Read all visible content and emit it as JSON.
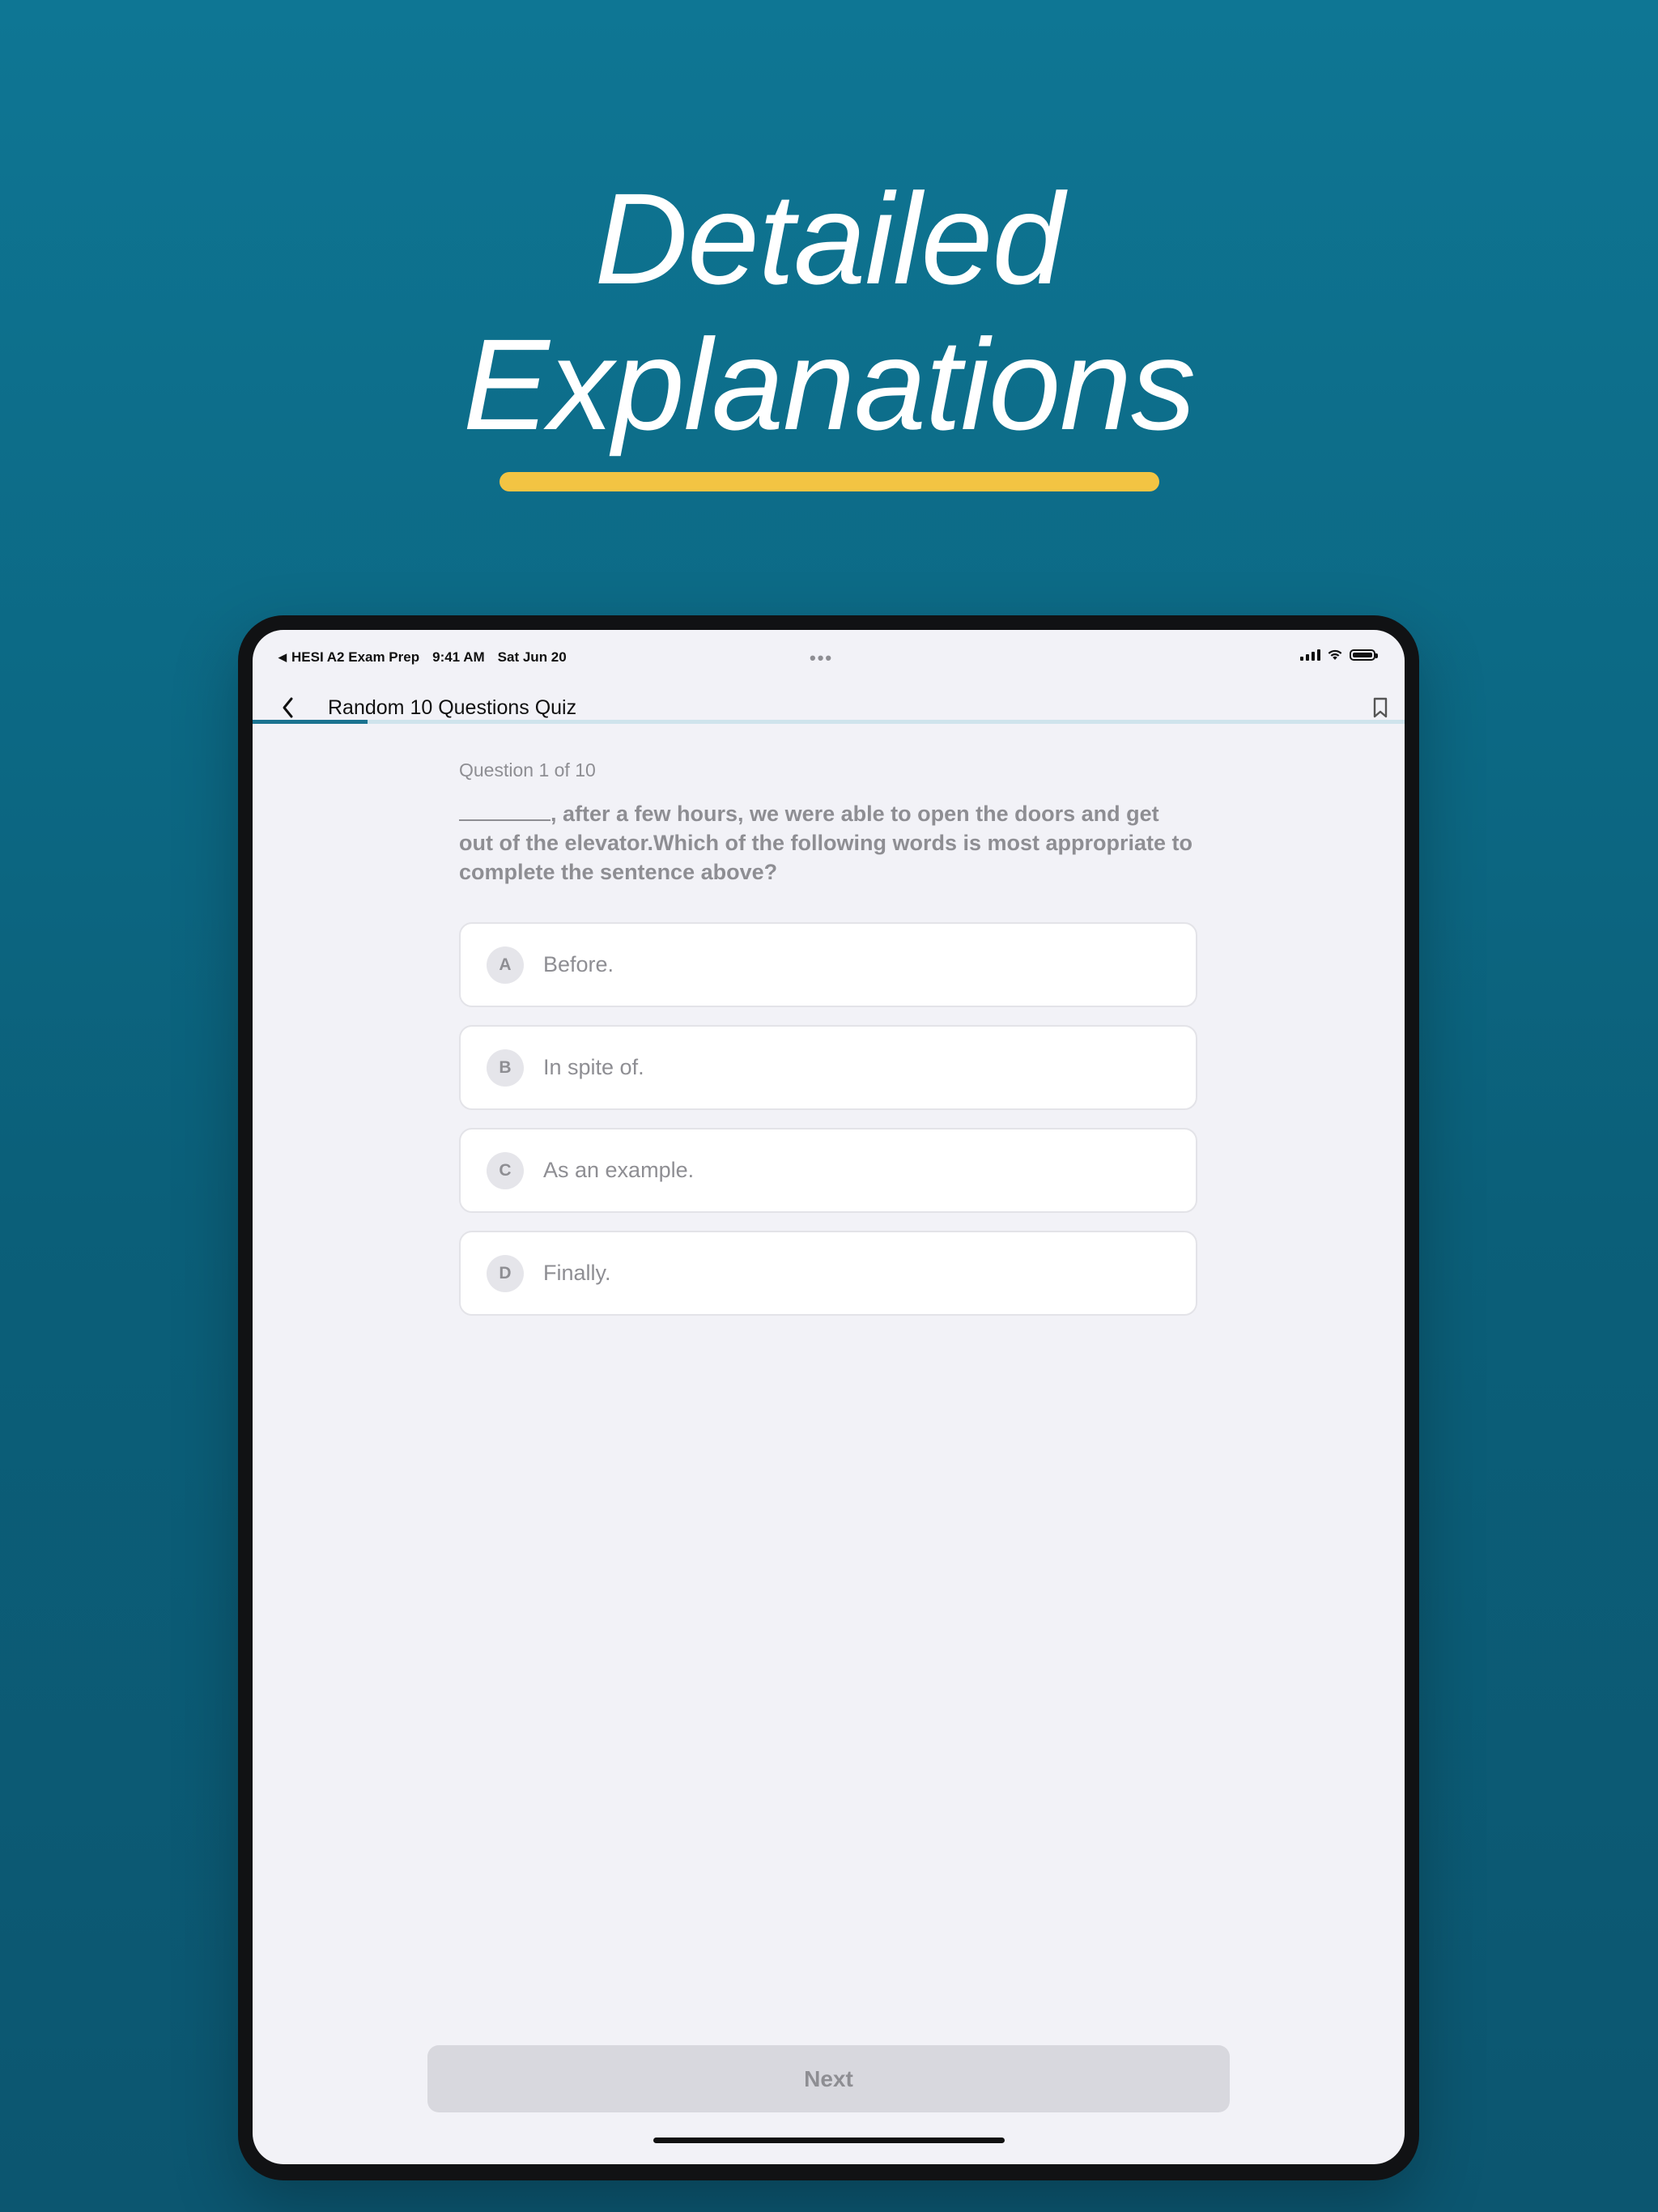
{
  "hero": {
    "line1": "Detailed",
    "line2": "Explanations",
    "accent_color": "#f3c443"
  },
  "status_bar": {
    "app_back": "HESI A2 Exam Prep",
    "time": "9:41 AM",
    "date": "Sat Jun 20",
    "dots": "•••"
  },
  "nav": {
    "title": "Random 10 Questions Quiz",
    "back_icon": "chevron-left-icon",
    "bookmark_icon": "bookmark-icon"
  },
  "progress": {
    "current": 1,
    "total": 10,
    "fraction": 0.1,
    "color": "#1b7390"
  },
  "question": {
    "counter": "Question 1 of 10",
    "text": ", after a few hours, we were able to open the doors and get out of the elevator.Which of the following words is most appropriate to complete the sentence above?"
  },
  "options": [
    {
      "letter": "A",
      "text": "Before."
    },
    {
      "letter": "B",
      "text": "In spite of."
    },
    {
      "letter": "C",
      "text": "As an example."
    },
    {
      "letter": "D",
      "text": "Finally."
    }
  ],
  "footer": {
    "next_label": "Next"
  }
}
